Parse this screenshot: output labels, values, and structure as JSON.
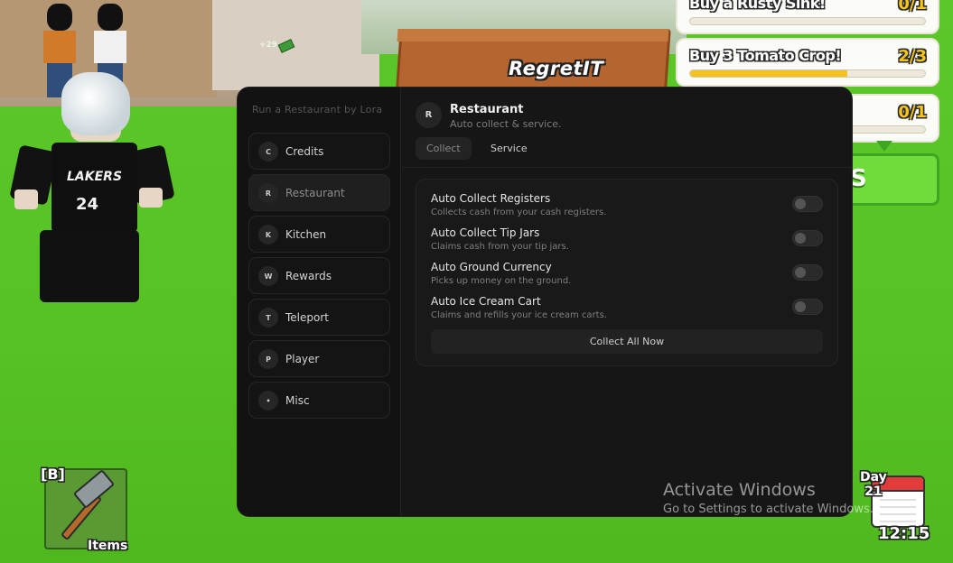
{
  "game": {
    "sign_text": "RegretIT",
    "cash_float": "+29",
    "hotbar": {
      "key_hint": "[B]",
      "item_label": "Items"
    },
    "day": {
      "label": "Day",
      "number": "21",
      "time": "12:15"
    },
    "jersey": {
      "text": "LAKERS",
      "number": "24"
    }
  },
  "quests": [
    {
      "title": "Buy a Rusty Sink!",
      "count": "0/1",
      "progress": 0.0
    },
    {
      "title": "Buy 3 Tomato Crop!",
      "count": "2/3",
      "progress": 0.67
    },
    {
      "title": "",
      "count": "0/1",
      "progress": 0.0
    }
  ],
  "claim_button": {
    "label": "S"
  },
  "panel": {
    "brand": "Run a Restaurant by Lora",
    "nav": [
      {
        "badge": "C",
        "label": "Credits",
        "active": false
      },
      {
        "badge": "R",
        "label": "Restaurant",
        "active": true
      },
      {
        "badge": "K",
        "label": "Kitchen",
        "active": false
      },
      {
        "badge": "W",
        "label": "Rewards",
        "active": false
      },
      {
        "badge": "T",
        "label": "Teleport",
        "active": false
      },
      {
        "badge": "P",
        "label": "Player",
        "active": false
      },
      {
        "badge": "•",
        "label": "Misc",
        "active": false
      }
    ],
    "header": {
      "badge": "R",
      "title": "Restaurant",
      "subtitle": "Auto collect & service."
    },
    "tabs": [
      {
        "label": "Collect",
        "active": true
      },
      {
        "label": "Service",
        "active": false
      }
    ],
    "rows": [
      {
        "title": "Auto Collect Registers",
        "desc": "Collects cash from your cash registers.",
        "enabled": false
      },
      {
        "title": "Auto Collect Tip Jars",
        "desc": "Claims cash from your tip jars.",
        "enabled": false
      },
      {
        "title": "Auto Ground Currency",
        "desc": "Picks up money on the ground.",
        "enabled": false
      },
      {
        "title": "Auto Ice Cream Cart",
        "desc": "Claims and refills your ice cream carts.",
        "enabled": false
      }
    ],
    "action_button": "Collect All Now"
  },
  "watermark": {
    "title": "Activate Windows",
    "subtitle": "Go to Settings to activate Windows."
  },
  "colors": {
    "panel_bg": "#161616",
    "quest_fill": "#f6c21d",
    "grass": "#56c223"
  }
}
